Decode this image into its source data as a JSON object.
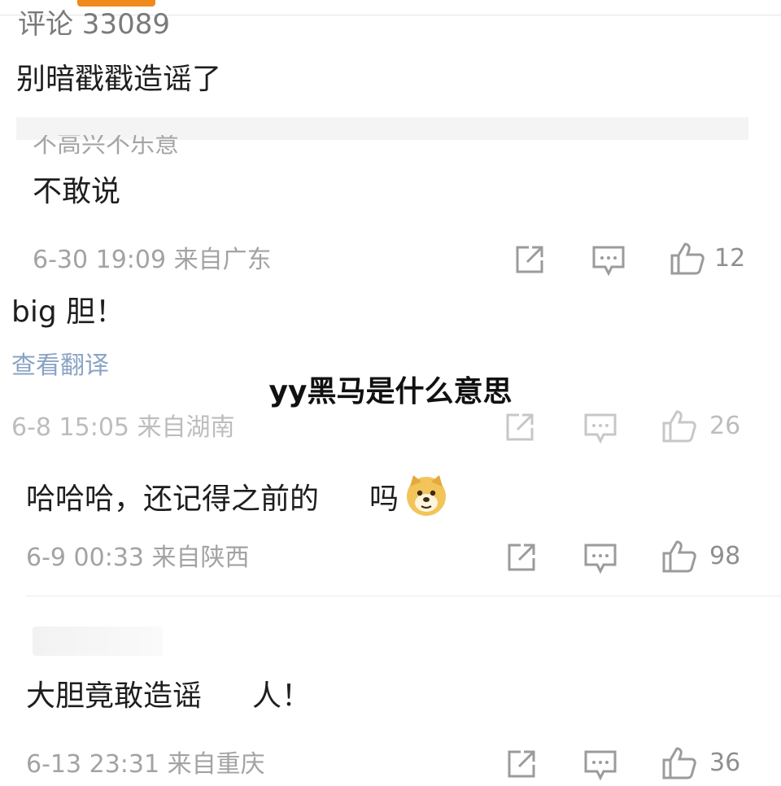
{
  "comments": [
    {
      "partial_top": "评论 33089",
      "text": "别暗戳戳造谣了"
    },
    {
      "partial_quote": "不高兴不乐意",
      "text": "不敢说",
      "time": "6-30 19:09",
      "location": "来自广东",
      "likes": "12"
    },
    {
      "text": "big 胆！",
      "translate_link": "查看翻译",
      "time": "6-8 15:05",
      "location": "来自湖南",
      "likes": "26"
    },
    {
      "text": "哈哈哈，还记得之前的",
      "text_tail": "吗",
      "emoji": "doge-emoji",
      "time": "6-9 00:33",
      "location": "来自陕西",
      "likes": "98"
    },
    {
      "text": "大胆竟敢造谣",
      "text_tail": "人！",
      "time": "6-13 23:31",
      "location": "来自重庆",
      "likes": "36"
    }
  ],
  "overlay": {
    "title": "yy黑马是什么意思"
  },
  "icons": {
    "share": "share-icon",
    "comment": "comment-icon",
    "like": "thumbs-up-icon"
  },
  "colors": {
    "accent": "#f08a1c",
    "link": "#8aa3c4",
    "meta": "#a3a3a3"
  }
}
